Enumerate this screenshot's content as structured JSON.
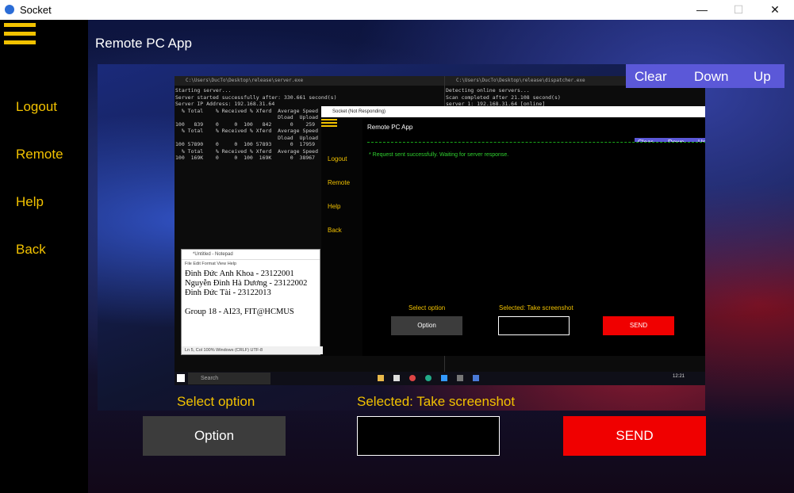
{
  "window": {
    "title": "Socket",
    "minimize": "—",
    "maximize": "☐",
    "close": "✕"
  },
  "sidebar": {
    "menu_icon": "hamburger-icon",
    "items": [
      {
        "label": "Logout"
      },
      {
        "label": "Remote"
      },
      {
        "label": "Help"
      },
      {
        "label": "Back"
      }
    ]
  },
  "main": {
    "title": "Remote PC App",
    "controls": {
      "clear": "Clear",
      "down": "Down",
      "up": "Up"
    },
    "select_label": "Select option",
    "selected_label": "Selected: Take screenshot",
    "option_button": "Option",
    "selected_value": "",
    "send_button": "SEND"
  },
  "screenshot": {
    "server_window_title": "C:\\Users\\DucTo\\Desktop\\release\\server.exe",
    "server_output": "Starting server...\nServer started successfully after: 330.661 second(s)\nServer IP Address: 192.168.31.64\n  % Total    % Received % Xferd  Average Speed\n                                 Dload  Upload\n100   839    0     0  100   842      0    259\n  % Total    % Received % Xferd  Average Speed\n                                 Dload  Upload\n100 57890    0     0  100 57893      0  17959\n  % Total    % Received % Xferd  Average Speed\n100  169K    0     0  100  169K      0  38967",
    "dispatcher_window_title": "C:\\Users\\DucTo\\Desktop\\release\\dispatcher.exe",
    "dispatcher_output": "Detecting online servers...\nScan completed after 21.108 second(s)\nserver 1: 192.168.31.64 [online]",
    "inner_app": {
      "window_title": "Socket (Not Responding)",
      "title": "Remote PC App",
      "nav": [
        "Logout",
        "Remote",
        "Help",
        "Back"
      ],
      "controls": [
        "Clear",
        "Down",
        "Up"
      ],
      "console_line": "* Request sent successfully. Waiting for server response.",
      "select_label": "Select option",
      "selected_label": "Selected: Take screenshot",
      "option_button": "Option",
      "send_button": "SEND"
    },
    "notepad": {
      "window_title": "*Untitled - Notepad",
      "menu": "File   Edit   Format   View   Help",
      "text": "Đinh Đức Anh Khoa - 23122001\nNguyễn Đình Hà Dương - 23122002\nĐinh Đức Tài - 23122013\n\nGroup 18 - AI23, FIT@HCMUS",
      "status": "Ln 5, Col  100%     Windows (CRLF)      UTF-8"
    },
    "taskbar": {
      "search": "Search",
      "clock": "12:21"
    }
  },
  "colors": {
    "accent_yellow": "#f2c200",
    "control_bar": "#5b58d8",
    "send_red": "#f00000",
    "option_gray": "#3c3c3c",
    "console_green": "#2fd02f"
  }
}
